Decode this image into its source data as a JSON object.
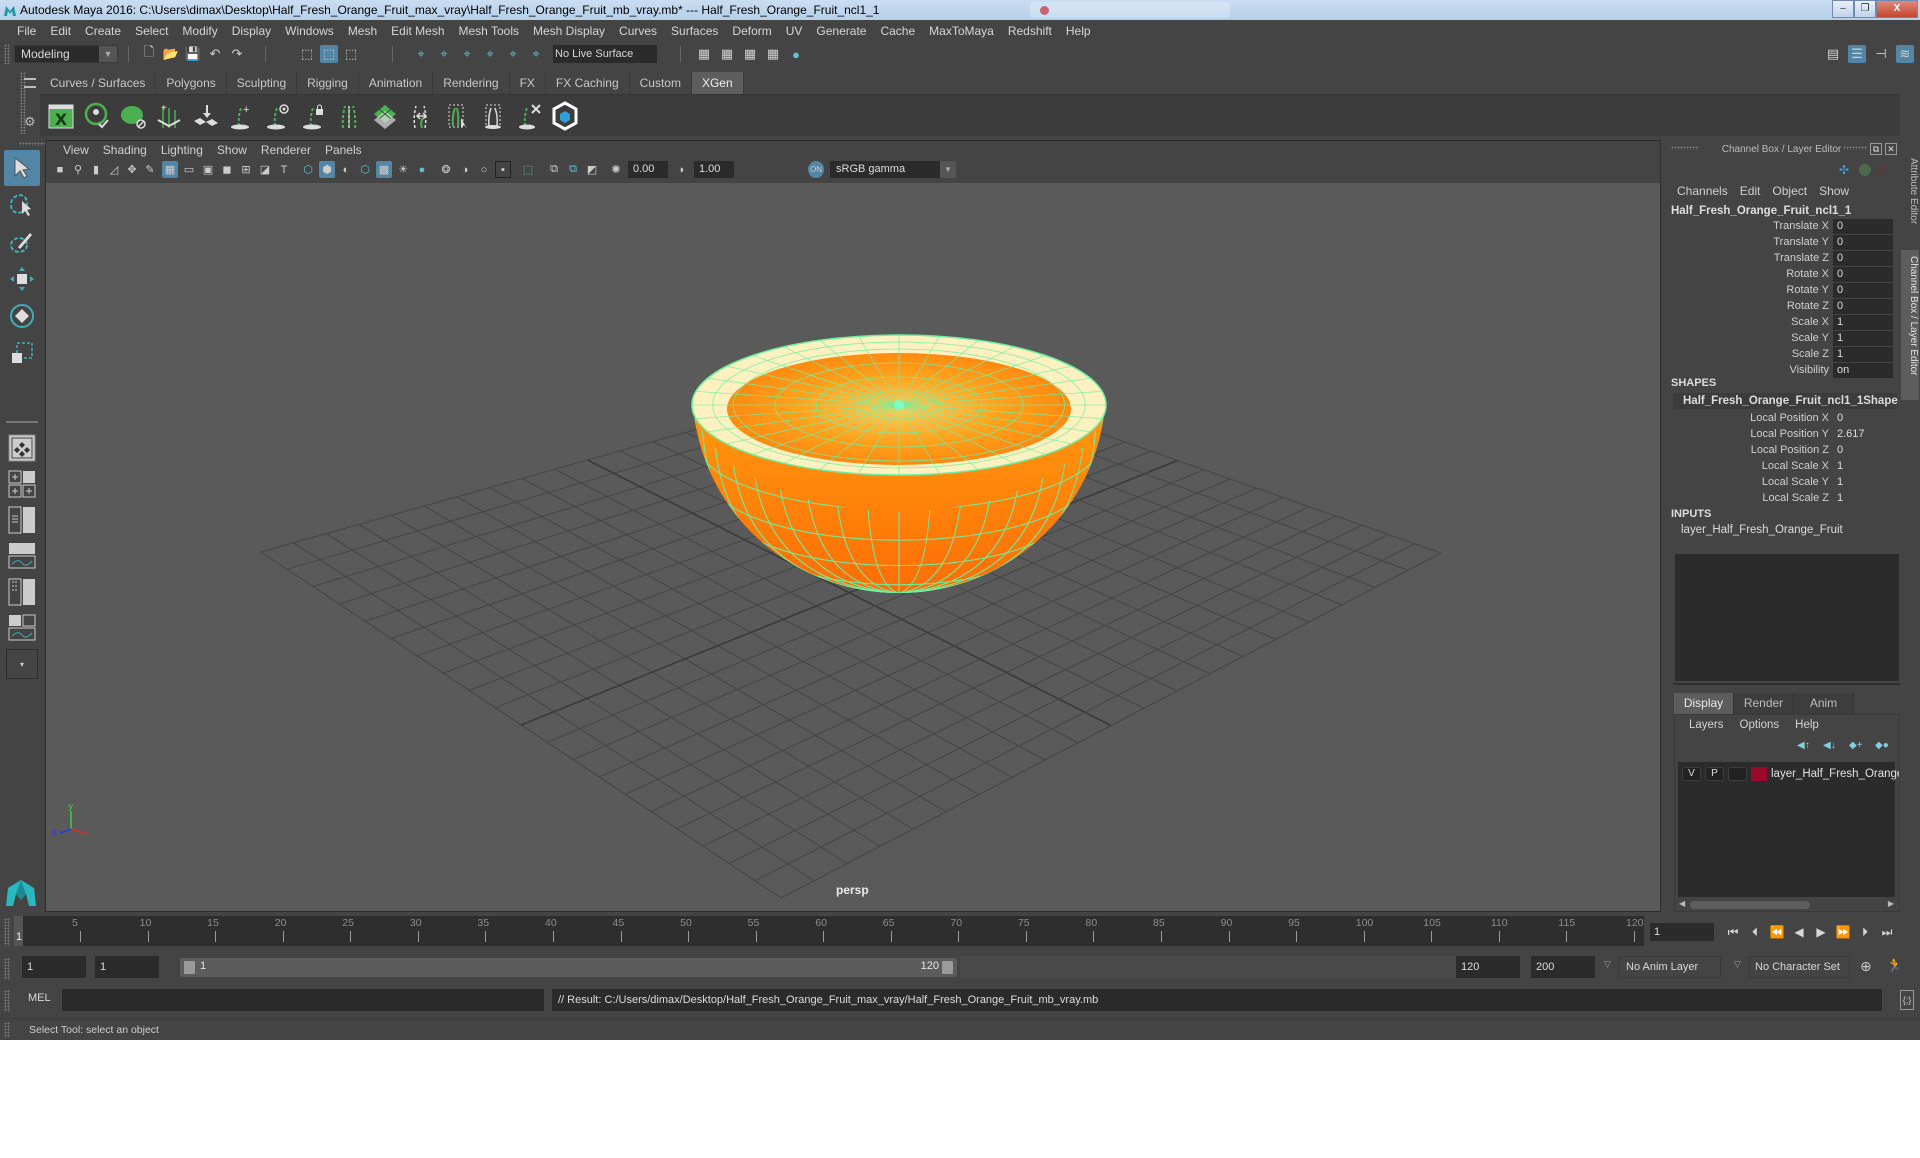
{
  "window": {
    "title": "Autodesk Maya 2016: C:\\Users\\dimax\\Desktop\\Half_Fresh_Orange_Fruit_max_vray\\Half_Fresh_Orange_Fruit_mb_vray.mb*   ---   Half_Fresh_Orange_Fruit_ncl1_1",
    "minimize": "–",
    "restore": "❐",
    "close": "X"
  },
  "menubar": [
    "File",
    "Edit",
    "Create",
    "Select",
    "Modify",
    "Display",
    "Windows",
    "Mesh",
    "Edit Mesh",
    "Mesh Tools",
    "Mesh Display",
    "Curves",
    "Surfaces",
    "Deform",
    "UV",
    "Generate",
    "Cache",
    "MaxToMaya",
    "Redshift",
    "Help"
  ],
  "statusline": {
    "mode": "Modeling",
    "live_surface": "No Live Surface"
  },
  "shelf": {
    "tabs": [
      "Curves / Surfaces",
      "Polygons",
      "Sculpting",
      "Rigging",
      "Animation",
      "Rendering",
      "FX",
      "FX Caching",
      "Custom",
      "XGen"
    ],
    "active_tab": "XGen",
    "icons": [
      "xgen-editor-icon",
      "xgen-preview-icon",
      "xgen-clear-preview-icon",
      "xgen-add-guides-icon",
      "xgen-place-guides-icon",
      "xgen-add-guide-icon",
      "xgen-guide-visibility-icon",
      "xgen-lock-guides-icon",
      "xgen-guide-spread-icon",
      "xgen-create-description-icon",
      "xgen-sculpt-guides-icon",
      "xgen-select-guides-icon",
      "xgen-deselect-guides-icon",
      "xgen-delete-guides-icon",
      "xgen-bake-icon"
    ]
  },
  "toolbox": [
    "select-tool-icon",
    "lasso-tool-icon",
    "paint-select-tool-icon",
    "move-tool-icon",
    "rotate-tool-icon",
    "scale-tool-icon"
  ],
  "viewport": {
    "menus": [
      "View",
      "Shading",
      "Lighting",
      "Show",
      "Renderer",
      "Panels"
    ],
    "exposure": "0.00",
    "gamma": "1.00",
    "color_space": "sRGB gamma",
    "camera_label": "persp",
    "axis": {
      "x": "x",
      "y": "y",
      "z": "z"
    },
    "object_name": "Half_Fresh_Orange_Fruit_ncl1_1"
  },
  "channel_box": {
    "header": "Channel Box / Layer Editor",
    "menus": [
      "Channels",
      "Edit",
      "Object",
      "Show"
    ],
    "object": "Half_Fresh_Orange_Fruit_ncl1_1",
    "channels": [
      {
        "label": "Translate X",
        "value": "0"
      },
      {
        "label": "Translate Y",
        "value": "0"
      },
      {
        "label": "Translate Z",
        "value": "0"
      },
      {
        "label": "Rotate X",
        "value": "0"
      },
      {
        "label": "Rotate Y",
        "value": "0"
      },
      {
        "label": "Rotate Z",
        "value": "0"
      },
      {
        "label": "Scale X",
        "value": "1"
      },
      {
        "label": "Scale Y",
        "value": "1"
      },
      {
        "label": "Scale Z",
        "value": "1"
      },
      {
        "label": "Visibility",
        "value": "on"
      }
    ],
    "shapes_title": "SHAPES",
    "shape_name": "Half_Fresh_Orange_Fruit_ncl1_1Shape",
    "shape_channels": [
      {
        "label": "Local Position X",
        "value": "0"
      },
      {
        "label": "Local Position Y",
        "value": "2.617"
      },
      {
        "label": "Local Position Z",
        "value": "0"
      },
      {
        "label": "Local Scale X",
        "value": "1"
      },
      {
        "label": "Local Scale Y",
        "value": "1"
      },
      {
        "label": "Local Scale Z",
        "value": "1"
      }
    ],
    "inputs_title": "INPUTS",
    "input_name": "layer_Half_Fresh_Orange_Fruit"
  },
  "side_tabs": [
    "Attribute Editor",
    "Channel Box / Layer Editor"
  ],
  "layer_editor": {
    "tabs": [
      "Display",
      "Render",
      "Anim"
    ],
    "active_tab": "Display",
    "menus": [
      "Layers",
      "Options",
      "Help"
    ],
    "layers": [
      {
        "visible": "V",
        "playback": "P",
        "name": "layer_Half_Fresh_Orange_Fruit",
        "color": "#9b0a2a"
      }
    ]
  },
  "timeline": {
    "ticks": [
      5,
      10,
      15,
      20,
      25,
      30,
      35,
      40,
      45,
      50,
      55,
      60,
      65,
      70,
      75,
      80,
      85,
      90,
      95,
      100,
      105,
      110,
      115,
      120
    ],
    "min": 1,
    "max": 120,
    "current_frame": "1",
    "current_frame_field": "1"
  },
  "range": {
    "start": "1",
    "playback_start": "1",
    "slider_start": "1",
    "slider_end": "120",
    "playback_end": "120",
    "end": "200",
    "anim_layer": "No Anim Layer",
    "character_set": "No Character Set"
  },
  "command_line": {
    "label": "MEL",
    "input": "",
    "result": "// Result: C:/Users/dimax/Desktop/Half_Fresh_Orange_Fruit_max_vray/Half_Fresh_Orange_Fruit_mb_vray.mb"
  },
  "help_line": "Select Tool: select an object",
  "colors": {
    "accent": "#5285a6",
    "wireframe": "#6ef0a0",
    "orange": "#ff8a10",
    "layer_color": "#9b0a2a"
  }
}
